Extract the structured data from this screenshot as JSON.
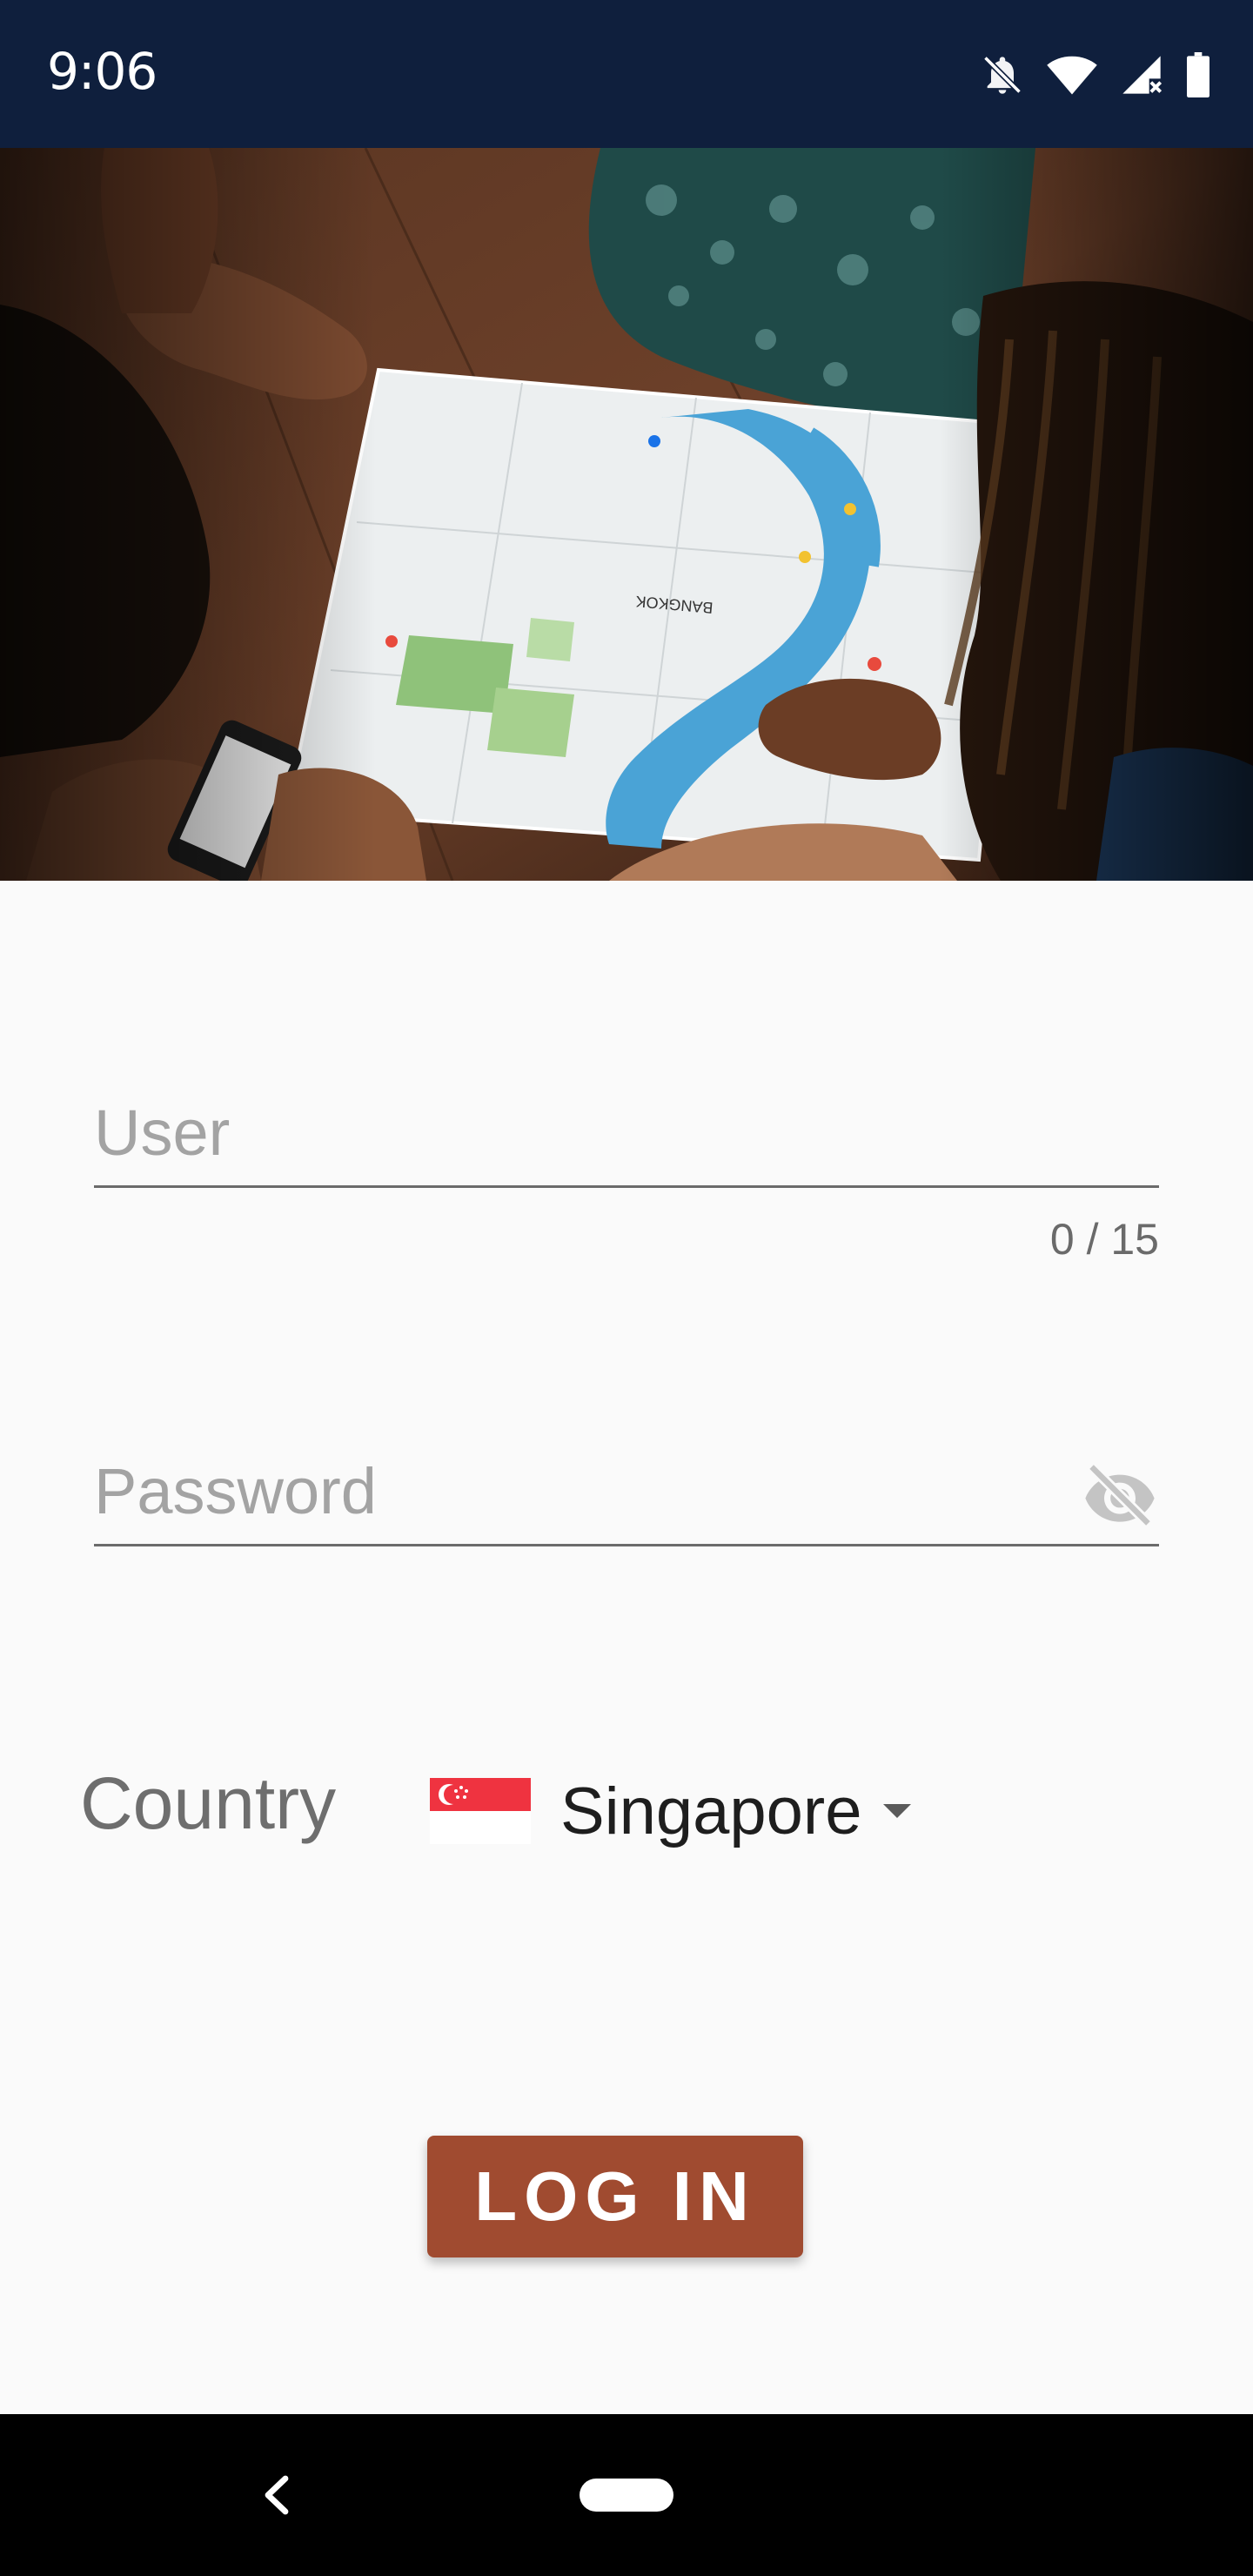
{
  "status_bar": {
    "time": "9:06",
    "icons": [
      "notifications-off-icon",
      "wifi-icon",
      "cellular-signal-icon",
      "battery-icon"
    ]
  },
  "hero": {
    "image_subject": "people-reading-bangkok-map-photo"
  },
  "form": {
    "user_placeholder": "User",
    "user_counter": "0 / 15",
    "password_placeholder": "Password",
    "password_toggle_icon": "visibility-off-icon",
    "country_label": "Country",
    "country_value": "Singapore",
    "country_flag_icon": "singapore-flag-icon"
  },
  "actions": {
    "login_label": "LOG IN"
  },
  "nav_bar": {
    "icons": [
      "back-icon",
      "home-pill-icon"
    ]
  },
  "colors": {
    "status_bar": "#0f1f3d",
    "background": "#fafafa",
    "login_button": "#a04b30",
    "nav_bar": "#000000"
  }
}
